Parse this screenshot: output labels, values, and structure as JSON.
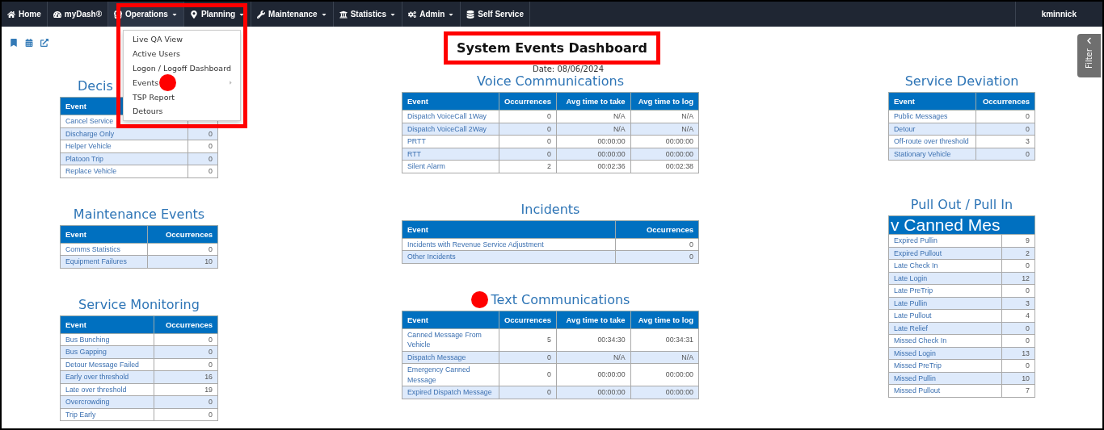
{
  "navbar": {
    "items": [
      {
        "label": "Home",
        "dropdown": false,
        "expanded": false
      },
      {
        "label": "myDash®",
        "dropdown": false,
        "expanded": false
      },
      {
        "label": "Operations",
        "dropdown": true,
        "expanded": true
      },
      {
        "label": "Planning",
        "dropdown": true,
        "expanded": false
      },
      {
        "label": "Maintenance",
        "dropdown": true,
        "expanded": false
      },
      {
        "label": "Statistics",
        "dropdown": true,
        "expanded": false
      },
      {
        "label": "Admin",
        "dropdown": true,
        "expanded": false
      },
      {
        "label": "Self Service",
        "dropdown": false,
        "expanded": false
      }
    ],
    "user": "kminnick"
  },
  "operations_menu": [
    {
      "label": "Live QA View",
      "submenu": false
    },
    {
      "label": "Active Users",
      "submenu": false
    },
    {
      "label": "Logon / Logoff Dashboard",
      "submenu": false
    },
    {
      "label": "Events",
      "submenu": true
    },
    {
      "label": "TSP Report",
      "submenu": false
    },
    {
      "label": "Detours",
      "submenu": false
    }
  ],
  "page": {
    "title": "System Events Dashboard",
    "date": "Date: 08/06/2024"
  },
  "filter_tab": {
    "label": "Filter"
  },
  "columns": [
    [
      {
        "title": "Decis",
        "truncated": true,
        "columns": [
          "Event"
        ],
        "rows": [
          {
            "cells": [
              "Cancel Service"
            ]
          },
          {
            "cells": [
              "Discharge Only",
              "0"
            ]
          },
          {
            "cells": [
              "Helper Vehicle",
              "0"
            ]
          },
          {
            "cells": [
              "Platoon Trip",
              "0"
            ]
          },
          {
            "cells": [
              "Replace Vehicle",
              "0"
            ]
          }
        ]
      },
      {
        "title": "Maintenance Events",
        "columns": [
          "Event",
          "Occurrences"
        ],
        "rows": [
          {
            "cells": [
              "Comms Statistics",
              "0"
            ]
          },
          {
            "cells": [
              "Equipment Failures",
              "10"
            ]
          }
        ]
      },
      {
        "title": "Service Monitoring",
        "columns": [
          "Event",
          "Occurrences"
        ],
        "rows": [
          {
            "cells": [
              "Bus Bunching",
              "0"
            ]
          },
          {
            "cells": [
              "Bus Gapping",
              "0"
            ]
          },
          {
            "cells": [
              "Detour Message Failed",
              "0"
            ]
          },
          {
            "cells": [
              "Early over threshold",
              "16"
            ]
          },
          {
            "cells": [
              "Late over threshold",
              "19"
            ]
          },
          {
            "cells": [
              "Overcrowding",
              "0"
            ]
          },
          {
            "cells": [
              "Trip Early",
              "0"
            ]
          }
        ]
      }
    ],
    [
      {
        "title": "Voice Communications",
        "columns": [
          "Event",
          "Occurrences",
          "Avg time to take",
          "Avg time to log"
        ],
        "rows": [
          {
            "cells": [
              "Dispatch VoiceCall 1Way",
              "0",
              "N/A",
              "N/A"
            ]
          },
          {
            "cells": [
              "Dispatch VoiceCall 2Way",
              "0",
              "N/A",
              "N/A"
            ]
          },
          {
            "cells": [
              "PRTT",
              "0",
              "00:00:00",
              "00:00:00"
            ]
          },
          {
            "cells": [
              "RTT",
              "0",
              "00:00:00",
              "00:00:00"
            ]
          },
          {
            "cells": [
              "Silent Alarm",
              "2",
              "00:02:36",
              "00:02:38"
            ]
          }
        ]
      },
      {
        "title": "Incidents",
        "columns": [
          "Event",
          "Occurrences"
        ],
        "rows": [
          {
            "cells": [
              "Incidents with Revenue Service Adjustment",
              "0"
            ]
          },
          {
            "cells": [
              "Other Incidents",
              "0"
            ]
          }
        ]
      },
      {
        "title": "Text Communications",
        "marker": true,
        "columns": [
          "Event",
          "Occurrences",
          "Avg time to take",
          "Avg time to log"
        ],
        "rows": [
          {
            "cells": [
              "Canned Message From Vehicle",
              "5",
              "00:34:30",
              "00:34:31"
            ]
          },
          {
            "cells": [
              "Dispatch Message",
              "0",
              "N/A",
              "N/A"
            ]
          },
          {
            "cells": [
              "Emergency Canned Message",
              "0",
              "00:00:00",
              "00:00:00"
            ]
          },
          {
            "cells": [
              "Expired Dispatch Message",
              "0",
              "00:00:00",
              "00:00:00"
            ]
          }
        ]
      }
    ],
    [
      {
        "title": "Service Deviation",
        "columns": [
          "Event",
          "Occurrences"
        ],
        "rows": [
          {
            "cells": [
              "Public Messages",
              "0"
            ]
          },
          {
            "cells": [
              "Detour",
              "0"
            ]
          },
          {
            "cells": [
              "Off-route over threshold",
              "3"
            ]
          },
          {
            "cells": [
              "Stationary Vehicle",
              "0"
            ]
          }
        ]
      },
      {
        "title": "Pull Out / Pull In",
        "overlay_text": "v Canned Mes",
        "rows": [
          {
            "cells": [
              "Expired Pullin",
              "9"
            ]
          },
          {
            "cells": [
              "Expired Pullout",
              "2"
            ]
          },
          {
            "cells": [
              "Late Check In",
              "0"
            ]
          },
          {
            "cells": [
              "Late Login",
              "12"
            ]
          },
          {
            "cells": [
              "Late PreTrip",
              "0"
            ]
          },
          {
            "cells": [
              "Late Pullin",
              "3"
            ]
          },
          {
            "cells": [
              "Late Pullout",
              "4"
            ]
          },
          {
            "cells": [
              "Late Relief",
              "0"
            ]
          },
          {
            "cells": [
              "Missed Check In",
              "0"
            ]
          },
          {
            "cells": [
              "Missed Login",
              "13"
            ]
          },
          {
            "cells": [
              "Missed PreTrip",
              "0"
            ]
          },
          {
            "cells": [
              "Missed Pullin",
              "10"
            ]
          },
          {
            "cells": [
              "Missed Pullout",
              "7"
            ]
          }
        ]
      }
    ]
  ]
}
